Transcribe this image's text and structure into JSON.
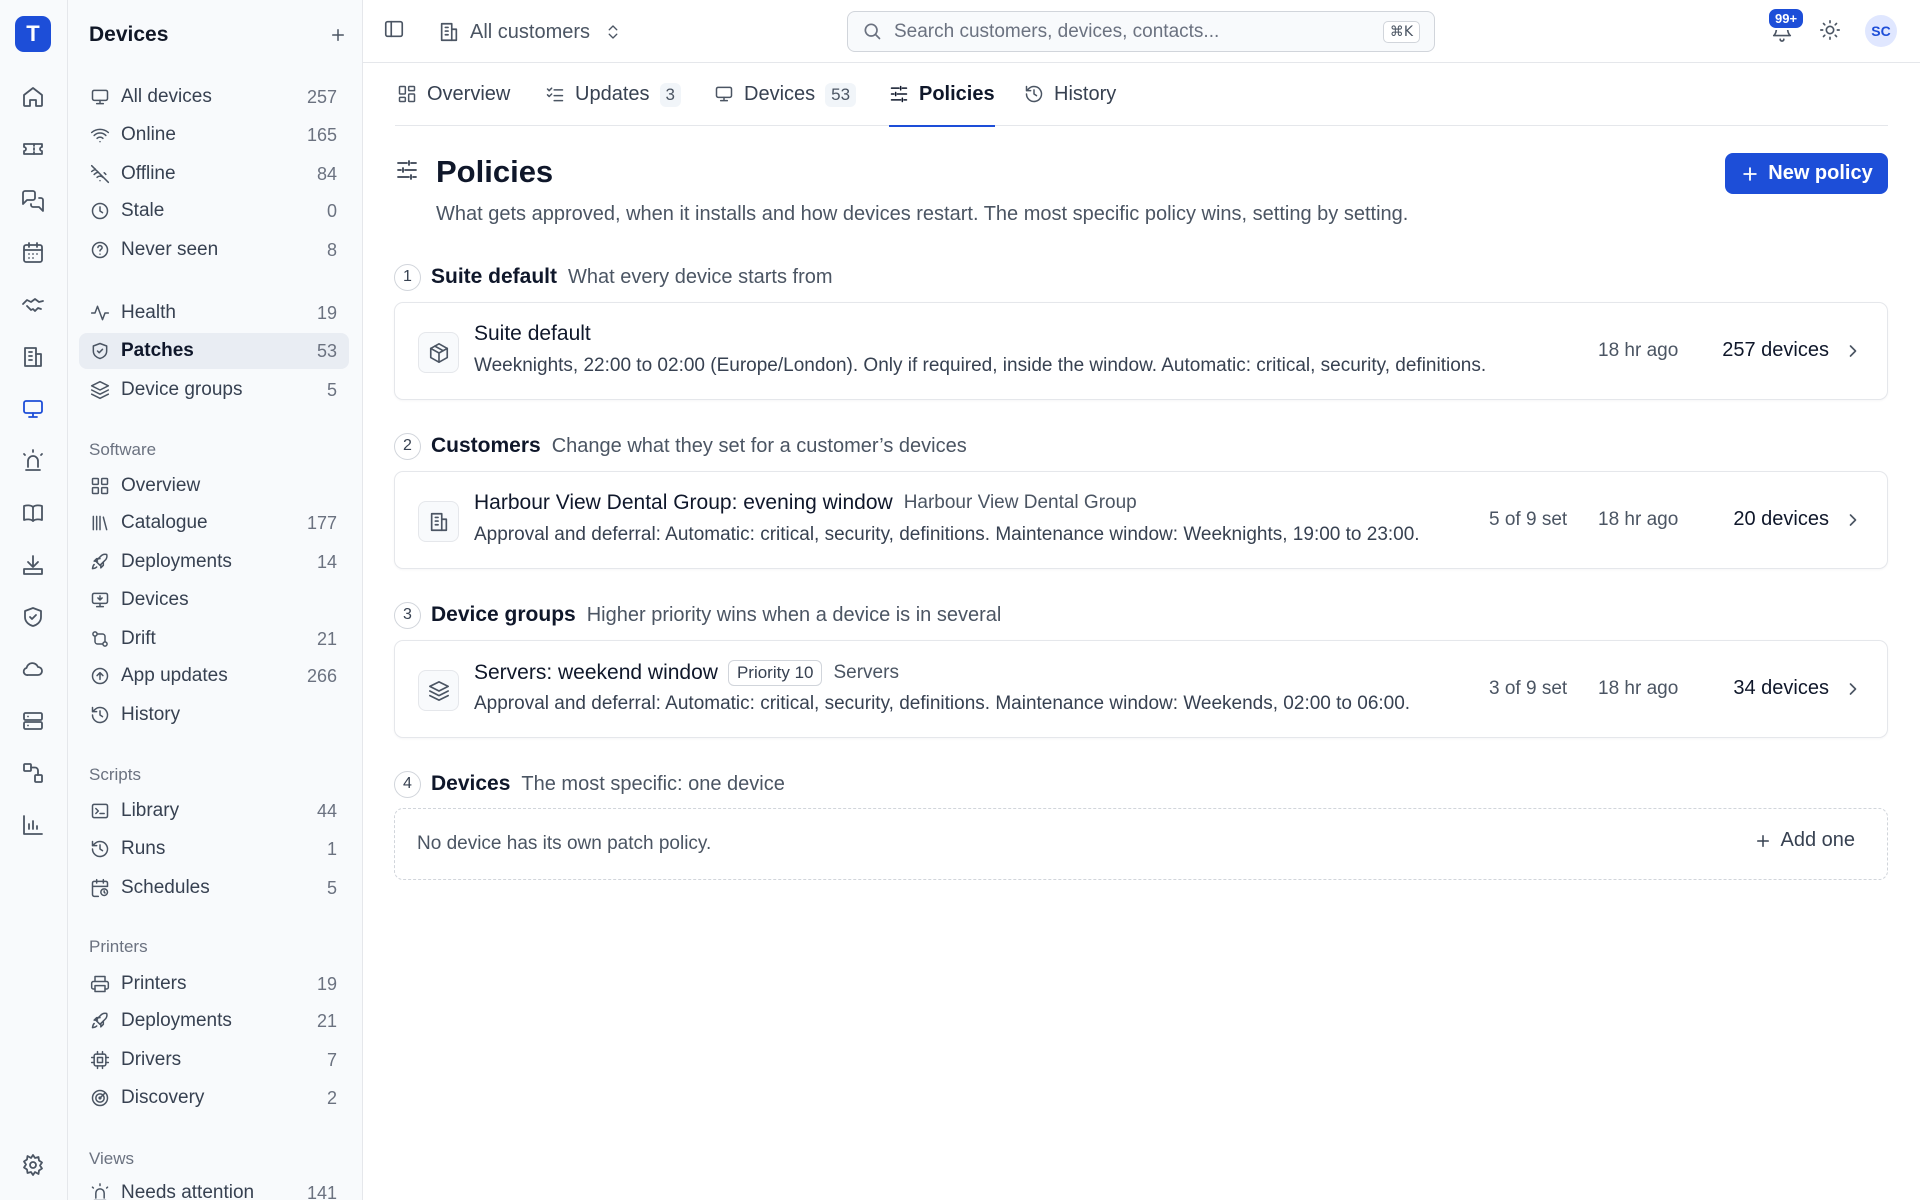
{
  "app": {
    "logo_letter": "T"
  },
  "sidebar": {
    "title": "Devices",
    "groups": [
      {
        "items": [
          {
            "label": "All devices",
            "count": "257",
            "icon": "monitor-icon"
          },
          {
            "label": "Online",
            "count": "165",
            "icon": "wifi-icon"
          },
          {
            "label": "Offline",
            "count": "84",
            "icon": "wifi-off-icon"
          },
          {
            "label": "Stale",
            "count": "0",
            "icon": "clock-icon"
          },
          {
            "label": "Never seen",
            "count": "8",
            "icon": "help-circle-icon"
          }
        ]
      },
      {
        "items": [
          {
            "label": "Health",
            "count": "19",
            "icon": "activity-icon"
          },
          {
            "label": "Patches",
            "count": "53",
            "icon": "shield-check-icon",
            "active": true
          },
          {
            "label": "Device groups",
            "count": "5",
            "icon": "layers-icon"
          }
        ]
      }
    ],
    "sections": [
      {
        "title": "Software",
        "items": [
          {
            "label": "Overview",
            "count": "",
            "icon": "grid-icon"
          },
          {
            "label": "Catalogue",
            "count": "177",
            "icon": "library-icon"
          },
          {
            "label": "Deployments",
            "count": "14",
            "icon": "rocket-icon"
          },
          {
            "label": "Devices",
            "count": "",
            "icon": "monitor-down-icon"
          },
          {
            "label": "Drift",
            "count": "21",
            "icon": "git-compare-icon"
          },
          {
            "label": "App updates",
            "count": "266",
            "icon": "arrow-up-circle-icon"
          },
          {
            "label": "History",
            "count": "",
            "icon": "history-icon"
          }
        ]
      },
      {
        "title": "Scripts",
        "items": [
          {
            "label": "Library",
            "count": "44",
            "icon": "terminal-icon"
          },
          {
            "label": "Runs",
            "count": "1",
            "icon": "history-icon"
          },
          {
            "label": "Schedules",
            "count": "5",
            "icon": "calendar-clock-icon"
          }
        ]
      },
      {
        "title": "Printers",
        "items": [
          {
            "label": "Printers",
            "count": "19",
            "icon": "printer-icon"
          },
          {
            "label": "Deployments",
            "count": "21",
            "icon": "rocket-icon"
          },
          {
            "label": "Drivers",
            "count": "7",
            "icon": "cpu-icon"
          },
          {
            "label": "Discovery",
            "count": "2",
            "icon": "radar-icon"
          }
        ]
      },
      {
        "title": "Views",
        "items": [
          {
            "label": "Needs attention",
            "count": "141",
            "icon": "siren-icon"
          }
        ]
      }
    ]
  },
  "topbar": {
    "customer_label": "All customers",
    "search_placeholder": "Search customers, devices, contacts...",
    "search_shortcut": "⌘K",
    "notification_badge": "99+",
    "avatar_initials": "SC"
  },
  "tabs": [
    {
      "label": "Overview",
      "count": "",
      "icon": "layout-grid-icon"
    },
    {
      "label": "Updates",
      "count": "3",
      "icon": "list-checks-icon"
    },
    {
      "label": "Devices",
      "count": "53",
      "icon": "monitor-icon"
    },
    {
      "label": "Policies",
      "count": "",
      "icon": "sliders-icon",
      "active": true
    },
    {
      "label": "History",
      "count": "",
      "icon": "history-icon"
    }
  ],
  "page": {
    "title": "Policies",
    "description": "What gets approved, when it installs and how devices restart. The most specific policy wins, setting by setting.",
    "new_button": "New policy"
  },
  "sections": [
    {
      "number": "1",
      "name": "Suite default",
      "description": "What every device starts from",
      "card": {
        "icon": "package-icon",
        "title": "Suite default",
        "subtitle": "",
        "priority": "",
        "description": "Weeknights, 22:00 to 02:00 (Europe/London). Only if required, inside the window. Automatic: critical, security, definitions.",
        "settings": "",
        "updated": "18 hr ago",
        "devices": "257 devices"
      }
    },
    {
      "number": "2",
      "name": "Customers",
      "description": "Change what they set for a customer’s devices",
      "card": {
        "icon": "building-icon",
        "title": "Harbour View Dental Group: evening window",
        "subtitle": "Harbour View Dental Group",
        "priority": "",
        "description": "Approval and deferral: Automatic: critical, security, definitions. Maintenance window: Weeknights, 19:00 to 23:00.",
        "settings": "5 of 9 set",
        "updated": "18 hr ago",
        "devices": "20 devices"
      }
    },
    {
      "number": "3",
      "name": "Device groups",
      "description": "Higher priority wins when a device is in several",
      "card": {
        "icon": "layers-icon",
        "title": "Servers: weekend window",
        "subtitle": "Servers",
        "priority": "Priority 10",
        "description": "Approval and deferral: Automatic: critical, security, definitions. Maintenance window: Weekends, 02:00 to 06:00.",
        "settings": "3 of 9 set",
        "updated": "18 hr ago",
        "devices": "34 devices"
      }
    },
    {
      "number": "4",
      "name": "Devices",
      "description": "The most specific: one device",
      "empty": {
        "message": "No device has its own patch policy.",
        "action": "Add one"
      }
    }
  ]
}
